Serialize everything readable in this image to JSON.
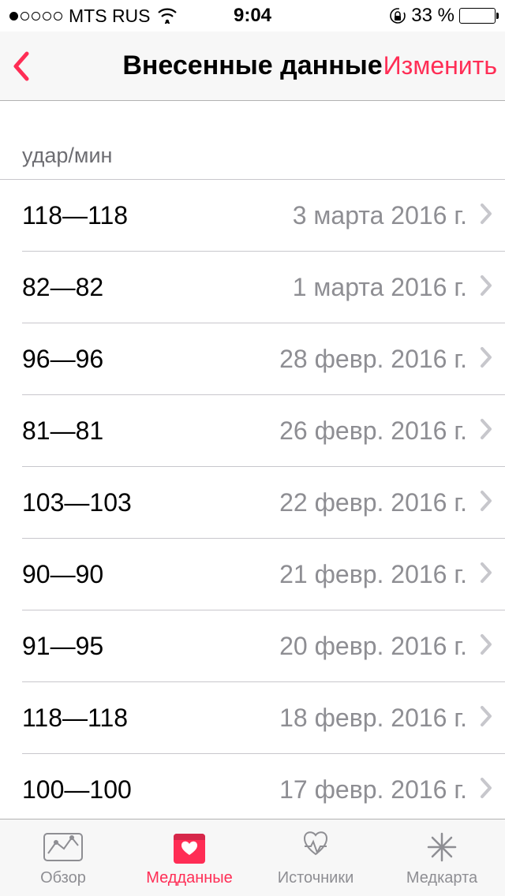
{
  "status_bar": {
    "carrier": "MTS RUS",
    "time": "9:04",
    "battery_text": "33 %"
  },
  "nav": {
    "title": "Внесенные данные",
    "edit_label": "Изменить"
  },
  "section_header": "удар/мин",
  "rows": [
    {
      "value": "118—118",
      "date": "3 марта 2016 г."
    },
    {
      "value": "82—82",
      "date": "1 марта 2016 г."
    },
    {
      "value": "96—96",
      "date": "28 февр. 2016 г."
    },
    {
      "value": "81—81",
      "date": "26 февр. 2016 г."
    },
    {
      "value": "103—103",
      "date": "22 февр. 2016 г."
    },
    {
      "value": "90—90",
      "date": "21 февр. 2016 г."
    },
    {
      "value": "91—95",
      "date": "20 февр. 2016 г."
    },
    {
      "value": "118—118",
      "date": "18 февр. 2016 г."
    },
    {
      "value": "100—100",
      "date": "17 февр. 2016 г."
    }
  ],
  "tabs": [
    {
      "label": "Обзор"
    },
    {
      "label": "Медданные"
    },
    {
      "label": "Источники"
    },
    {
      "label": "Медкарта"
    }
  ],
  "accent": "#ff2d55"
}
